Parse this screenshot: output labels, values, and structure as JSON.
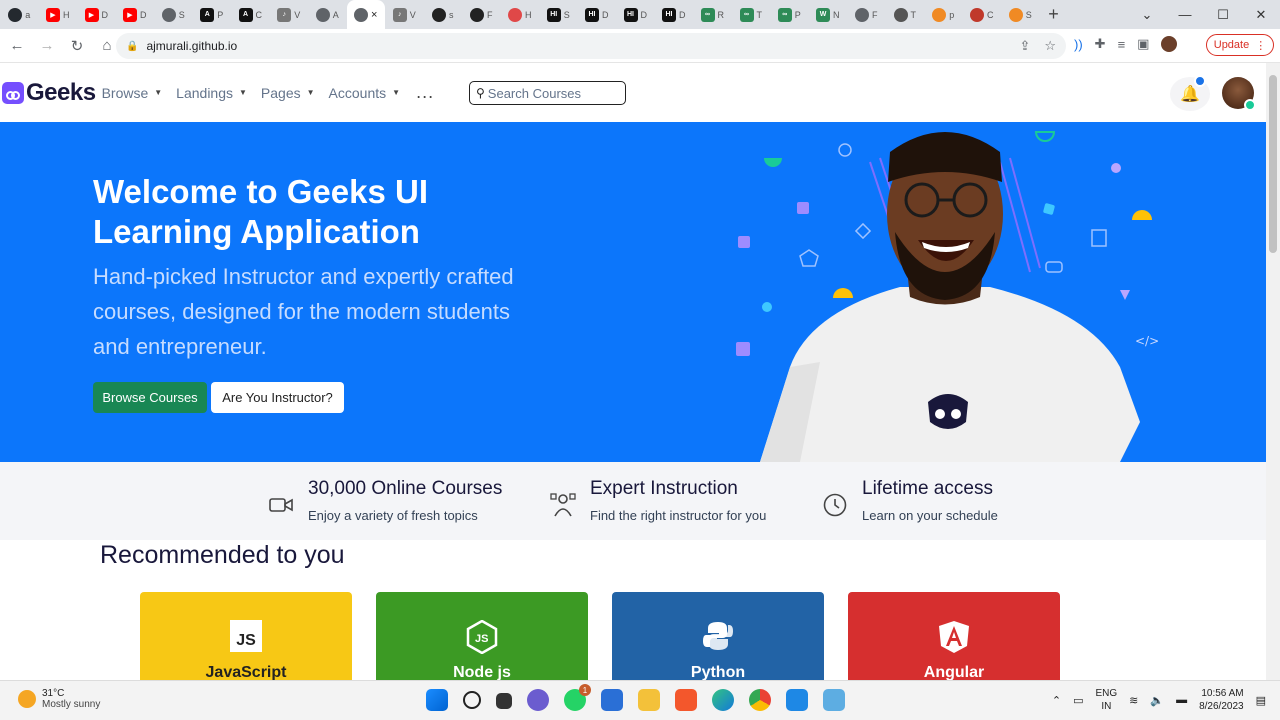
{
  "browser": {
    "tabs": [
      {
        "label": "a",
        "color": "#24292f",
        "glyph": ""
      },
      {
        "label": "H",
        "color": "#ff0000",
        "glyph": "▶"
      },
      {
        "label": "D",
        "color": "#ff0000",
        "glyph": "▶"
      },
      {
        "label": "D",
        "color": "#ff0000",
        "glyph": "▶"
      },
      {
        "label": "S",
        "color": "#5f6368",
        "glyph": ""
      },
      {
        "label": "P",
        "color": "#111111",
        "glyph": "A"
      },
      {
        "label": "C",
        "color": "#111111",
        "glyph": "A"
      },
      {
        "label": "V",
        "color": "#777777",
        "glyph": "♪"
      },
      {
        "label": "A",
        "color": "#5f6368",
        "glyph": ""
      },
      {
        "label": "×",
        "color": "#5f6368",
        "glyph": ""
      },
      {
        "label": "V",
        "color": "#777777",
        "glyph": "♪"
      },
      {
        "label": "s",
        "color": "#222222",
        "glyph": ""
      },
      {
        "label": "F",
        "color": "#222222",
        "glyph": ""
      },
      {
        "label": "H",
        "color": "#e04848",
        "glyph": ""
      },
      {
        "label": "S",
        "color": "#111111",
        "glyph": "HI"
      },
      {
        "label": "D",
        "color": "#111111",
        "glyph": "HI"
      },
      {
        "label": "D",
        "color": "#111111",
        "glyph": "HI"
      },
      {
        "label": "D",
        "color": "#111111",
        "glyph": "HI"
      },
      {
        "label": "R",
        "color": "#2e8b57",
        "glyph": "∞"
      },
      {
        "label": "T",
        "color": "#2e8b57",
        "glyph": "∞"
      },
      {
        "label": "P",
        "color": "#2e8b57",
        "glyph": "∞"
      },
      {
        "label": "N",
        "color": "#2e8b57",
        "glyph": "W"
      },
      {
        "label": "F",
        "color": "#5f6368",
        "glyph": ""
      },
      {
        "label": "T",
        "color": "#555555",
        "glyph": ""
      },
      {
        "label": "p",
        "color": "#f08a24",
        "glyph": ""
      },
      {
        "label": "C",
        "color": "#c0392b",
        "glyph": ""
      },
      {
        "label": "S",
        "color": "#f08a24",
        "glyph": ""
      }
    ],
    "url": "ajmurali.github.io",
    "update_label": "Update"
  },
  "navbar": {
    "logo": "Geeks",
    "menu": [
      "Browse",
      "Landings",
      "Pages",
      "Accounts"
    ],
    "more": "...",
    "search_placeholder": "Search Courses"
  },
  "hero": {
    "title": "Welcome to Geeks UI Learning Application",
    "subtitle": "Hand-picked Instructor and expertly crafted courses, designed for the modern students and entrepreneur.",
    "primary_button": "Browse Courses",
    "secondary_button": "Are You Instructor?"
  },
  "features": [
    {
      "title": "30,000 Online Courses",
      "desc": "Enjoy a variety of fresh topics",
      "icon": "video-icon"
    },
    {
      "title": "Expert Instruction",
      "desc": "Find the right instructor for you",
      "icon": "instructor-icon"
    },
    {
      "title": "Lifetime access",
      "desc": "Learn on your schedule",
      "icon": "clock-icon"
    }
  ],
  "recommended": {
    "heading": "Recommended to you",
    "courses": [
      {
        "name": "JavaScript",
        "color": "#f7c815",
        "text_color": "#222222"
      },
      {
        "name": "Node js",
        "color": "#3c9a24",
        "text_color": "#ffffff"
      },
      {
        "name": "Python",
        "color": "#2263a6",
        "text_color": "#ffffff"
      },
      {
        "name": "Angular",
        "color": "#d62f2f",
        "text_color": "#ffffff"
      }
    ]
  },
  "taskbar": {
    "temperature": "31°C",
    "weather": "Mostly sunny",
    "whatsapp_badge": "1",
    "lang1": "ENG",
    "lang2": "IN",
    "time": "10:56 AM",
    "date": "8/26/2023"
  }
}
